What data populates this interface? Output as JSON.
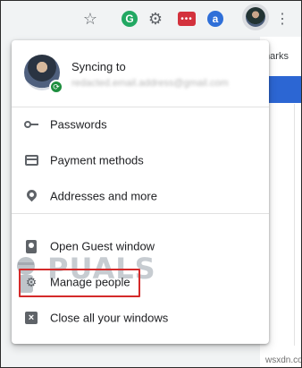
{
  "toolbar": {
    "icons": [
      "bookmark-star-icon",
      "grammarly-icon",
      "gear-extension-icon",
      "red-extension-icon",
      "blue-a-extension-icon",
      "profile-avatar-icon",
      "more-vert-icon"
    ],
    "g_letter": "G",
    "a_letter": "a",
    "red_dots": "•••",
    "gear_glyph": "⚙",
    "more_glyph": "⋮",
    "star_glyph": "☆"
  },
  "background": {
    "bookmarks_fragment": "marks",
    "watermark": "wsxdn.com",
    "accent_blue": "#2c66d3"
  },
  "menu": {
    "sync_title": "Syncing to",
    "sync_email": "redacted.email.address@gmail.com",
    "items": [
      {
        "label": "Passwords",
        "icon": "key-icon"
      },
      {
        "label": "Payment methods",
        "icon": "credit-card-icon"
      },
      {
        "label": "Addresses and more",
        "icon": "location-pin-icon"
      },
      {
        "label": "Open Guest window",
        "icon": "guest-icon"
      },
      {
        "label": "Manage people",
        "icon": "gear-icon"
      },
      {
        "label": "Close all your windows",
        "icon": "close-windows-icon"
      }
    ],
    "highlight_color": "#d42a2a"
  },
  "logo": {
    "text": "PUALS"
  }
}
